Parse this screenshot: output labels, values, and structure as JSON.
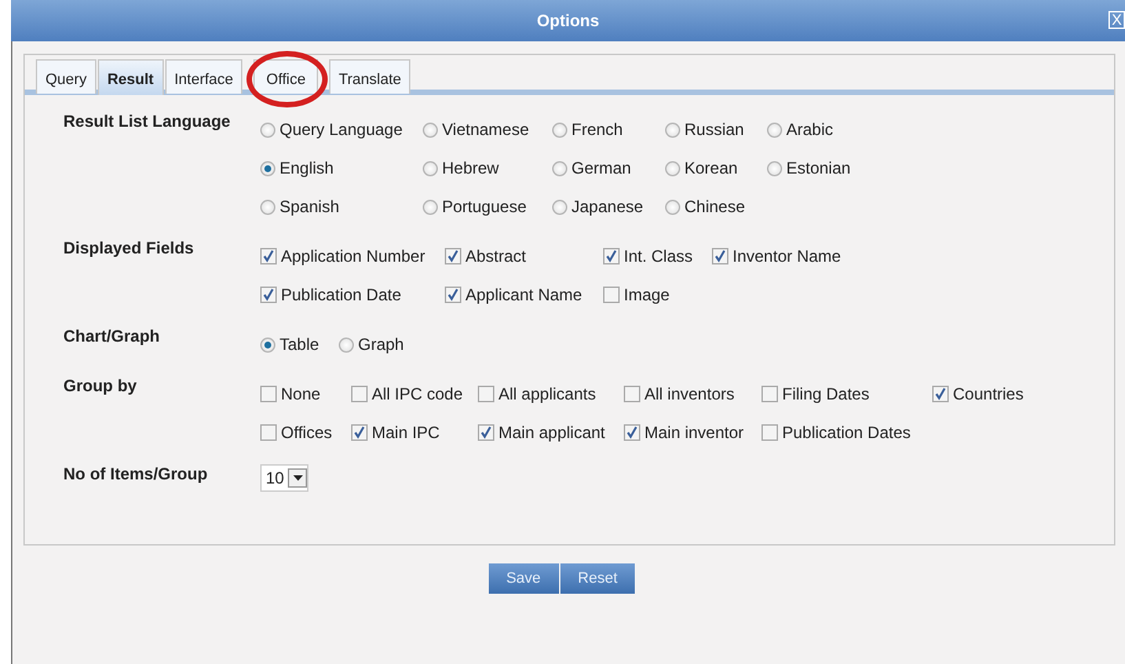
{
  "window": {
    "title": "Options",
    "close": "X"
  },
  "tabs": [
    {
      "label": "Query",
      "selected": false,
      "highlighted": false
    },
    {
      "label": "Result",
      "selected": true,
      "highlighted": false
    },
    {
      "label": "Interface",
      "selected": false,
      "highlighted": false
    },
    {
      "label": "Office",
      "selected": false,
      "highlighted": true
    },
    {
      "label": "Translate",
      "selected": false,
      "highlighted": false
    }
  ],
  "sections": [
    {
      "label": "Result List Language",
      "kind": "radio",
      "options": [
        {
          "label": "Query Language",
          "selected": false
        },
        {
          "label": "Vietnamese",
          "selected": false
        },
        {
          "label": "French",
          "selected": false
        },
        {
          "label": "Russian",
          "selected": false
        },
        {
          "label": "Arabic",
          "selected": false
        },
        {
          "label": "English",
          "selected": true
        },
        {
          "label": "Hebrew",
          "selected": false
        },
        {
          "label": "German",
          "selected": false
        },
        {
          "label": "Korean",
          "selected": false
        },
        {
          "label": "Estonian",
          "selected": false
        },
        {
          "label": "Spanish",
          "selected": false
        },
        {
          "label": "Portuguese",
          "selected": false
        },
        {
          "label": "Japanese",
          "selected": false
        },
        {
          "label": "Chinese",
          "selected": false
        }
      ]
    },
    {
      "label": "Displayed Fields",
      "kind": "check",
      "options": [
        {
          "label": "Application Number",
          "checked": true
        },
        {
          "label": "Abstract",
          "checked": true
        },
        {
          "label": "Int. Class",
          "checked": true
        },
        {
          "label": "Inventor Name",
          "checked": true
        },
        {
          "label": "Publication Date",
          "checked": true
        },
        {
          "label": "Applicant Name",
          "checked": true
        },
        {
          "label": "Image",
          "checked": false
        }
      ]
    },
    {
      "label": "Chart/Graph",
      "kind": "radio",
      "options": [
        {
          "label": "Table",
          "selected": true
        },
        {
          "label": "Graph",
          "selected": false
        }
      ]
    },
    {
      "label": "Group by",
      "kind": "check",
      "options": [
        {
          "label": "None",
          "checked": false
        },
        {
          "label": "All IPC code",
          "checked": false
        },
        {
          "label": "All applicants",
          "checked": false
        },
        {
          "label": "All inventors",
          "checked": false
        },
        {
          "label": "Filing Dates",
          "checked": false
        },
        {
          "label": "Countries",
          "checked": true
        },
        {
          "label": "Offices",
          "checked": false
        },
        {
          "label": "Main IPC",
          "checked": true
        },
        {
          "label": "Main applicant",
          "checked": true
        },
        {
          "label": "Main inventor",
          "checked": true
        },
        {
          "label": "Publication Dates",
          "checked": false
        }
      ]
    },
    {
      "label": "No of Items/Group",
      "kind": "select",
      "value": "10"
    }
  ],
  "buttons": [
    "Save",
    "Reset"
  ]
}
